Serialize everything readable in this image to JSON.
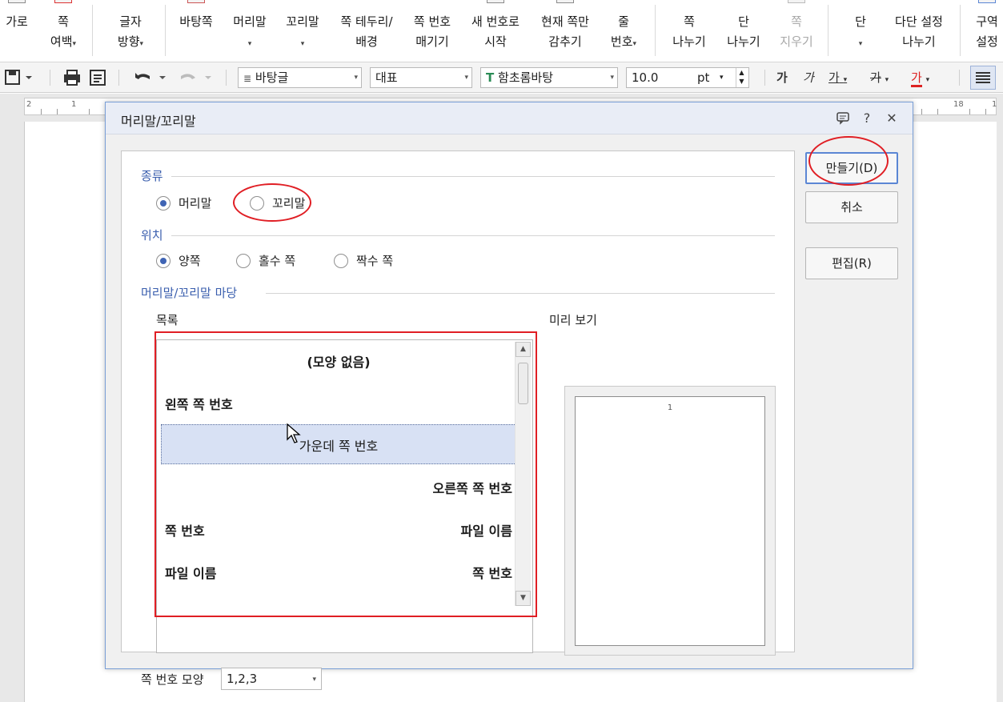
{
  "ribbon": {
    "items": [
      {
        "l1": "가로",
        "l2": ""
      },
      {
        "l1": "쪽",
        "l2": "여백",
        "arrow": true
      },
      {
        "l1": "글자",
        "l2": "방향",
        "arrow": true
      },
      {
        "l1": "바탕쪽",
        "l2": ""
      },
      {
        "l1": "머리말",
        "l2": "",
        "arrow_only": true
      },
      {
        "l1": "꼬리말",
        "l2": "",
        "arrow_only": true
      },
      {
        "l1": "쪽 테두리/",
        "l2": "배경"
      },
      {
        "l1": "쪽 번호",
        "l2": "매기기"
      },
      {
        "l1": "새 번호로",
        "l2": "시작"
      },
      {
        "l1": "현재 쪽만",
        "l2": "감추기"
      },
      {
        "l1": "줄",
        "l2": "번호",
        "arrow": true
      },
      {
        "l1": "쪽",
        "l2": "나누기"
      },
      {
        "l1": "단",
        "l2": "나누기"
      },
      {
        "l1": "쪽",
        "l2": "지우기",
        "disabled": true
      },
      {
        "l1": "단",
        "l2": "",
        "arrow_only": true
      },
      {
        "l1": "다단 설정",
        "l2": "나누기"
      },
      {
        "l1": "구역",
        "l2": "설정"
      }
    ]
  },
  "toolbar": {
    "style": "바탕글",
    "outline": "대표",
    "font": "함초롬바탕",
    "size": "10.0",
    "unit": "pt",
    "bold": "가",
    "italic": "가",
    "underline": "가",
    "strike": "가",
    "color": "가"
  },
  "ruler": {
    "n1": "2",
    "n2": "1",
    "n3": "18",
    "n4": "1"
  },
  "dialog": {
    "title": "머리말/꼬리말",
    "type_section": "종류",
    "type_header": "머리말",
    "type_footer": "꼬리말",
    "pos_section": "위치",
    "pos_both": "양쪽",
    "pos_odd": "홀수 쪽",
    "pos_even": "짝수 쪽",
    "madang_section": "머리말/꼬리말 마당",
    "list_label": "목록",
    "preview_label": "미리 보기",
    "preview_page_number": "1",
    "list_items": [
      {
        "left": "",
        "center": "(모양 없음)",
        "right": ""
      },
      {
        "left": "왼쪽 쪽 번호",
        "center": "",
        "right": ""
      },
      {
        "left": "",
        "center": "가운데 쪽 번호",
        "right": ""
      },
      {
        "left": "",
        "center": "",
        "right": "오른쪽 쪽 번호"
      },
      {
        "left": "쪽 번호",
        "center": "",
        "right": "파일 이름"
      },
      {
        "left": "파일 이름",
        "center": "",
        "right": "쪽 번호"
      }
    ],
    "page_number_format_label": "쪽 번호 모양",
    "page_number_format_value": "1,2,3",
    "btn_create": "만들기(D)",
    "btn_cancel": "취소",
    "btn_edit": "편집(R)"
  },
  "colors": {
    "annotation_red": "#e01e24",
    "section_blue": "#3b5fae",
    "selection_bg": "#d8e1f4",
    "dialog_border": "#7a9fd6"
  }
}
